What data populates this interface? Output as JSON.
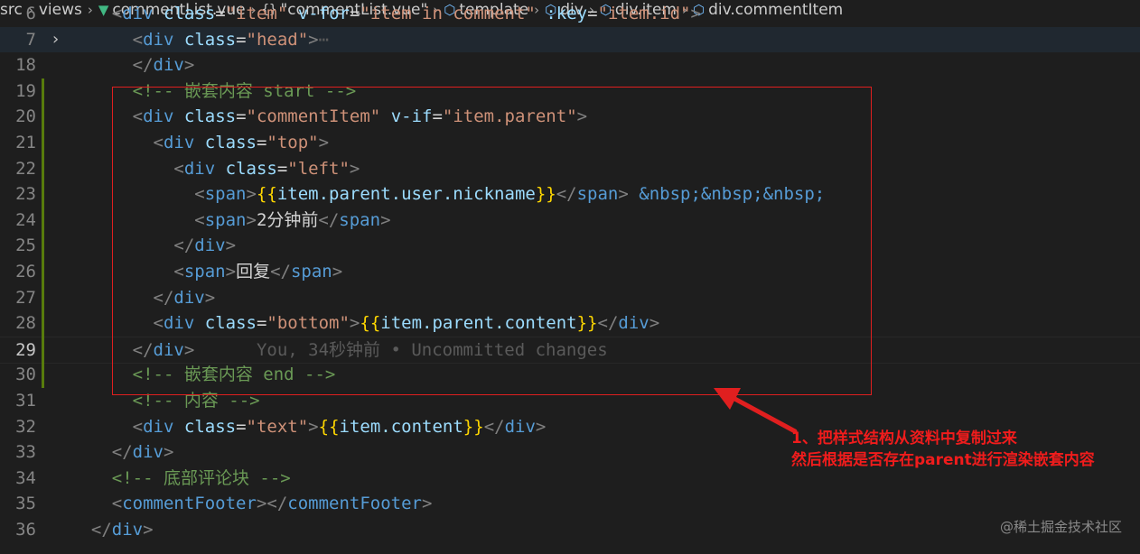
{
  "breadcrumb": {
    "items": [
      {
        "label": "src",
        "icon": ""
      },
      {
        "label": "views",
        "icon": ""
      },
      {
        "label": "commentList.vue",
        "icon": "vue-icon"
      },
      {
        "label": "\"commentList.vue\"",
        "icon": "json-braces-icon"
      },
      {
        "label": "template",
        "icon": "cube-icon"
      },
      {
        "label": "div",
        "icon": "cube-icon"
      },
      {
        "label": "div.item",
        "icon": "cube-icon"
      },
      {
        "label": "div.commentItem",
        "icon": "cube-icon"
      }
    ]
  },
  "code_lines": [
    {
      "num": "6",
      "text": "    <div class=\"item\" v-for=\"item in comment\" :key=\"item.id\">"
    },
    {
      "num": "7",
      "text": "      <div class=\"head\">⋯",
      "folded": true
    },
    {
      "num": "18",
      "text": "      </div>"
    },
    {
      "num": "19",
      "text": "      <!-- 嵌套内容 start -->"
    },
    {
      "num": "20",
      "text": "      <div class=\"commentItem\" v-if=\"item.parent\">"
    },
    {
      "num": "21",
      "text": "        <div class=\"top\">"
    },
    {
      "num": "22",
      "text": "          <div class=\"left\">"
    },
    {
      "num": "23",
      "text": "            <span>{{item.parent.user.nickname}}</span> &nbsp;&nbsp;&nbsp;"
    },
    {
      "num": "24",
      "text": "            <span>2分钟前</span>"
    },
    {
      "num": "25",
      "text": "          </div>"
    },
    {
      "num": "26",
      "text": "          <span>回复</span>"
    },
    {
      "num": "27",
      "text": "        </div>"
    },
    {
      "num": "28",
      "text": "        <div class=\"bottom\">{{item.parent.content}}</div>"
    },
    {
      "num": "29",
      "text": "      </div>",
      "ghost": "You, 34秒钟前 • Uncommitted changes"
    },
    {
      "num": "30",
      "text": "      <!-- 嵌套内容 end -->"
    },
    {
      "num": "31",
      "text": "      <!-- 内容 -->"
    },
    {
      "num": "32",
      "text": "      <div class=\"text\">{{item.content}}</div>"
    },
    {
      "num": "33",
      "text": "    </div>"
    },
    {
      "num": "34",
      "text": "    <!-- 底部评论块 -->"
    },
    {
      "num": "35",
      "text": "    <commentFooter></commentFooter>"
    },
    {
      "num": "36",
      "text": "  </div>"
    }
  ],
  "annotation": {
    "line1": "1、把样式结构从资料中复制过来",
    "line2": "然后根据是否存在parent进行渲染嵌套内容"
  },
  "watermark": "@稀土掘金技术社区",
  "colors": {
    "annotation": "#f01c1c",
    "box": "#e01f1f"
  }
}
